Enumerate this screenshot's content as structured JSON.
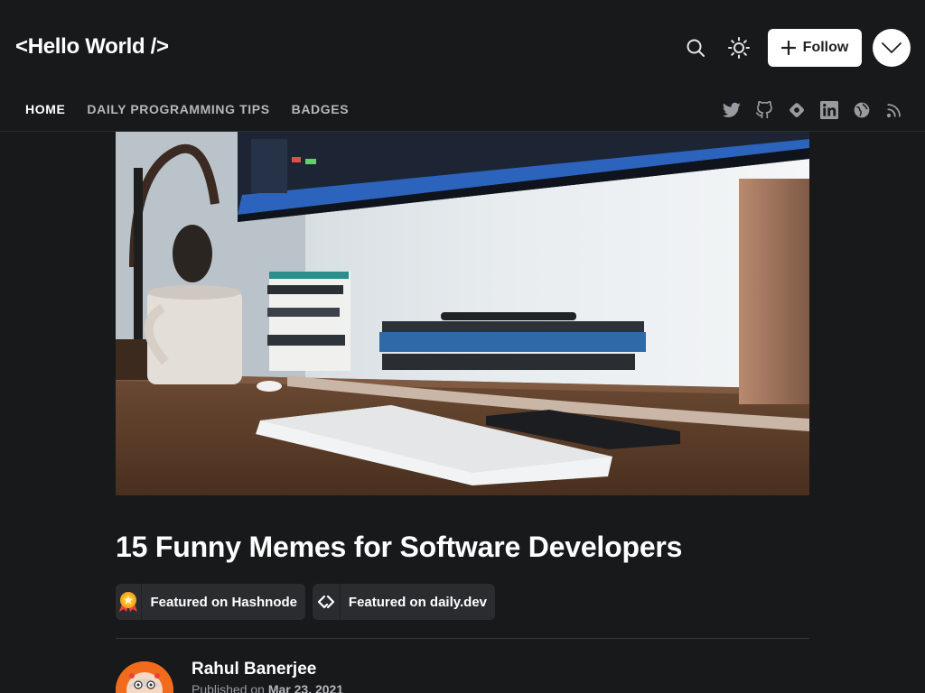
{
  "header": {
    "logo": "<Hello World />",
    "follow_label": "Follow"
  },
  "nav": {
    "items": [
      {
        "label": "HOME",
        "active": true
      },
      {
        "label": "DAILY PROGRAMMING TIPS",
        "active": false
      },
      {
        "label": "BADGES",
        "active": false
      }
    ]
  },
  "socials": [
    "twitter-icon",
    "github-icon",
    "hashnode-icon",
    "linkedin-icon",
    "website-icon",
    "rss-icon"
  ],
  "article": {
    "title": "15 Funny Memes for Software Developers",
    "badges": [
      {
        "label": "Featured on Hashnode",
        "icon": "hashnode-featured-icon"
      },
      {
        "label": "Featured on daily.dev",
        "icon": "dailydev-icon"
      }
    ],
    "author": {
      "name": "Rahul Banerjee",
      "published_prefix": "Published on",
      "published_date": "Mar 23, 2021"
    }
  },
  "colors": {
    "background": "#18191b",
    "badge_bg": "#2b2c2f",
    "accent_avatar": "#f26b1d"
  }
}
